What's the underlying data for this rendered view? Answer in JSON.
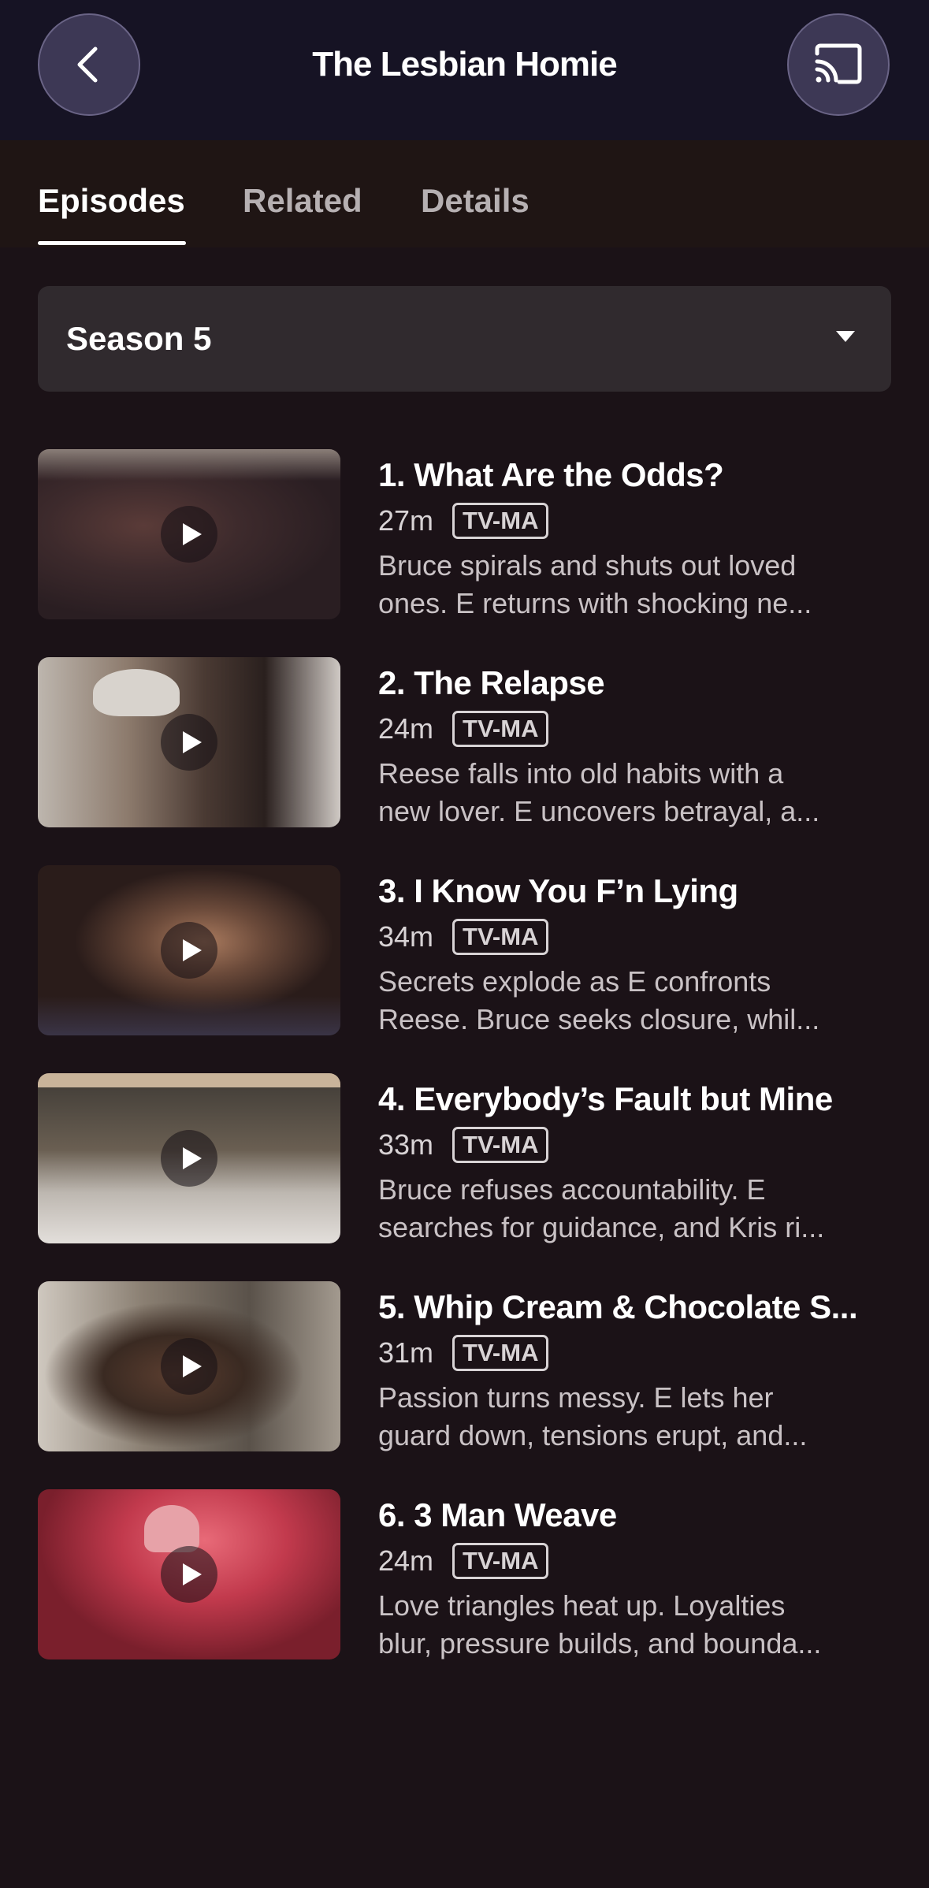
{
  "header": {
    "title": "The Lesbian Homie"
  },
  "tabs": [
    {
      "label": "Episodes",
      "active": true
    },
    {
      "label": "Related",
      "active": false
    },
    {
      "label": "Details",
      "active": false
    }
  ],
  "season_selector": {
    "value": "Season 5"
  },
  "episodes": [
    {
      "title": "1. What Are the Odds?",
      "duration": "27m",
      "rating": "TV-MA",
      "desc_line1": "Bruce spirals and shuts out loved",
      "desc_line2": "ones. E returns with shocking ne..."
    },
    {
      "title": "2. The Relapse",
      "duration": "24m",
      "rating": "TV-MA",
      "desc_line1": "Reese falls into old habits with a",
      "desc_line2": "new lover. E uncovers betrayal, a..."
    },
    {
      "title": "3. I Know You F’n Lying",
      "duration": "34m",
      "rating": "TV-MA",
      "desc_line1": "Secrets explode as E confronts",
      "desc_line2": "Reese. Bruce seeks closure, whil..."
    },
    {
      "title": "4. Everybody’s Fault but Mine",
      "duration": "33m",
      "rating": "TV-MA",
      "desc_line1": "Bruce refuses accountability. E",
      "desc_line2": "searches for guidance, and Kris ri..."
    },
    {
      "title": "5. Whip Cream & Chocolate S...",
      "duration": "31m",
      "rating": "TV-MA",
      "desc_line1": "Passion turns messy. E lets her",
      "desc_line2": "guard down, tensions erupt, and..."
    },
    {
      "title": "6. 3 Man Weave",
      "duration": "24m",
      "rating": "TV-MA",
      "desc_line1": "Love triangles heat up. Loyalties",
      "desc_line2": "blur, pressure builds, and bounda..."
    }
  ],
  "colors": {
    "header_bg": "#161324",
    "page_bg": "#1b1217",
    "select_bg": "#302a2e",
    "circle_btn_bg": "#3d3855"
  },
  "icons": {
    "back": "chevron-left-icon",
    "cast": "cast-icon",
    "caret": "caret-down-icon",
    "play": "play-icon"
  }
}
